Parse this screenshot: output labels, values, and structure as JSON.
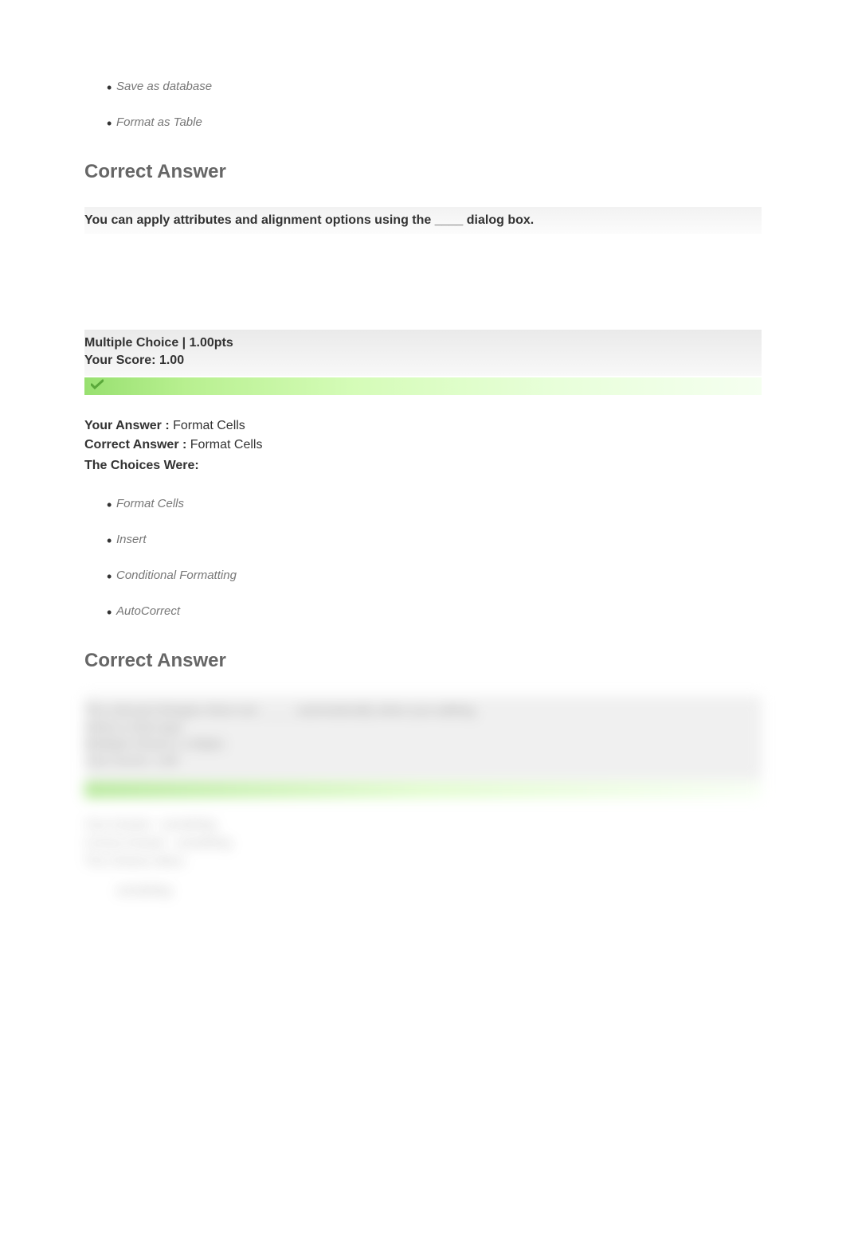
{
  "partial_choices": {
    "items": [
      "Save as database",
      "Format as Table"
    ]
  },
  "q1": {
    "heading": "Correct Answer",
    "question": "You can apply attributes and alignment options using the ____ dialog box.",
    "type_points": "Multiple Choice | 1.00pts",
    "score": "Your Score: 1.00",
    "your_answer_label": "Your Answer : ",
    "your_answer_value": "Format Cells",
    "correct_answer_label": "Correct Answer : ",
    "correct_answer_value": "Format Cells",
    "choices_header": "The Choices Were:",
    "choices": [
      "Format Cells",
      "Insert",
      "Conditional Formatting",
      "AutoCorrect"
    ]
  },
  "q2": {
    "heading": "Correct Answer",
    "blurred_question": "The relevant thingies there are _____ automatically when you adding",
    "blurred_meta1": "Select a that type",
    "blurred_meta2": "Multiple Choice | 1.00pts",
    "blurred_meta3": "Your Score: 1.00",
    "blurred_ya_label": "Your Answer : ",
    "blurred_ya_value": "something",
    "blurred_ca_label": "Correct Answer : ",
    "blurred_ca_value": "something",
    "blurred_choices_header": "The Choices Were:",
    "blurred_choice1": "something"
  }
}
